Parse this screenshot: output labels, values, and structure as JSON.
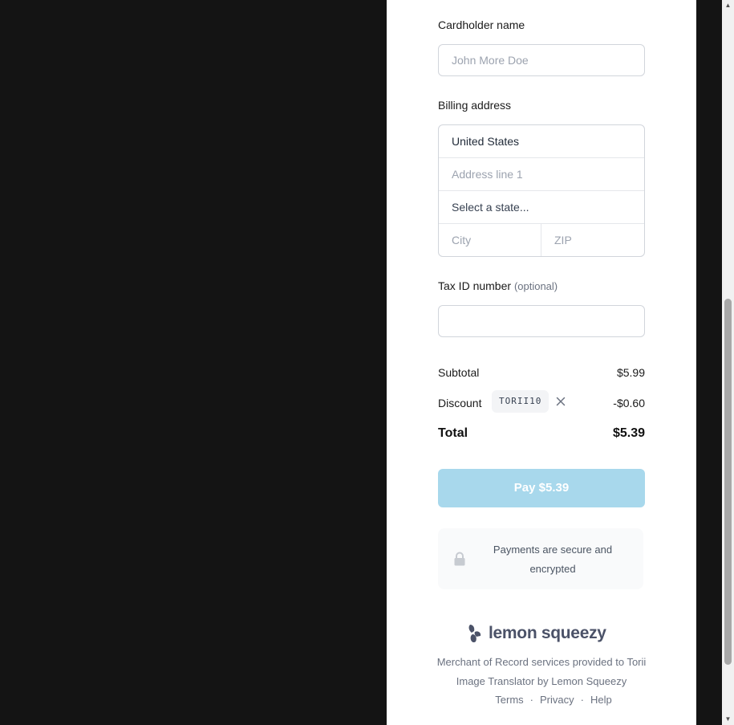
{
  "form": {
    "cardholder_label": "Cardholder name",
    "cardholder_placeholder": "John More Doe",
    "billing_label": "Billing address",
    "country_value": "United States",
    "address_placeholder": "Address line 1",
    "state_placeholder": "Select a state...",
    "city_placeholder": "City",
    "zip_placeholder": "ZIP",
    "taxid_label": "Tax ID number",
    "taxid_optional": "(optional)"
  },
  "summary": {
    "subtotal_label": "Subtotal",
    "subtotal_value": "$5.99",
    "discount_label": "Discount",
    "discount_code": "TORII10",
    "discount_value": "-$0.60",
    "total_label": "Total",
    "total_value": "$5.39"
  },
  "pay_button_label": "Pay $5.39",
  "secure_text": "Payments are secure and encrypted",
  "footer": {
    "brand": "lemon squeezy",
    "merchant_text": "Merchant of Record services provided to Torii Image Translator by Lemon Squeezy",
    "links": [
      "Terms",
      "Privacy",
      "Help"
    ],
    "separator": "·"
  },
  "icons": {
    "remove": "close-icon",
    "lock": "lock-icon",
    "logo": "lemon-squeezy-logo-icon"
  },
  "colors": {
    "pay_button": "#a8d8ec",
    "brand_text": "#4b5268",
    "backdrop": "#141414"
  }
}
